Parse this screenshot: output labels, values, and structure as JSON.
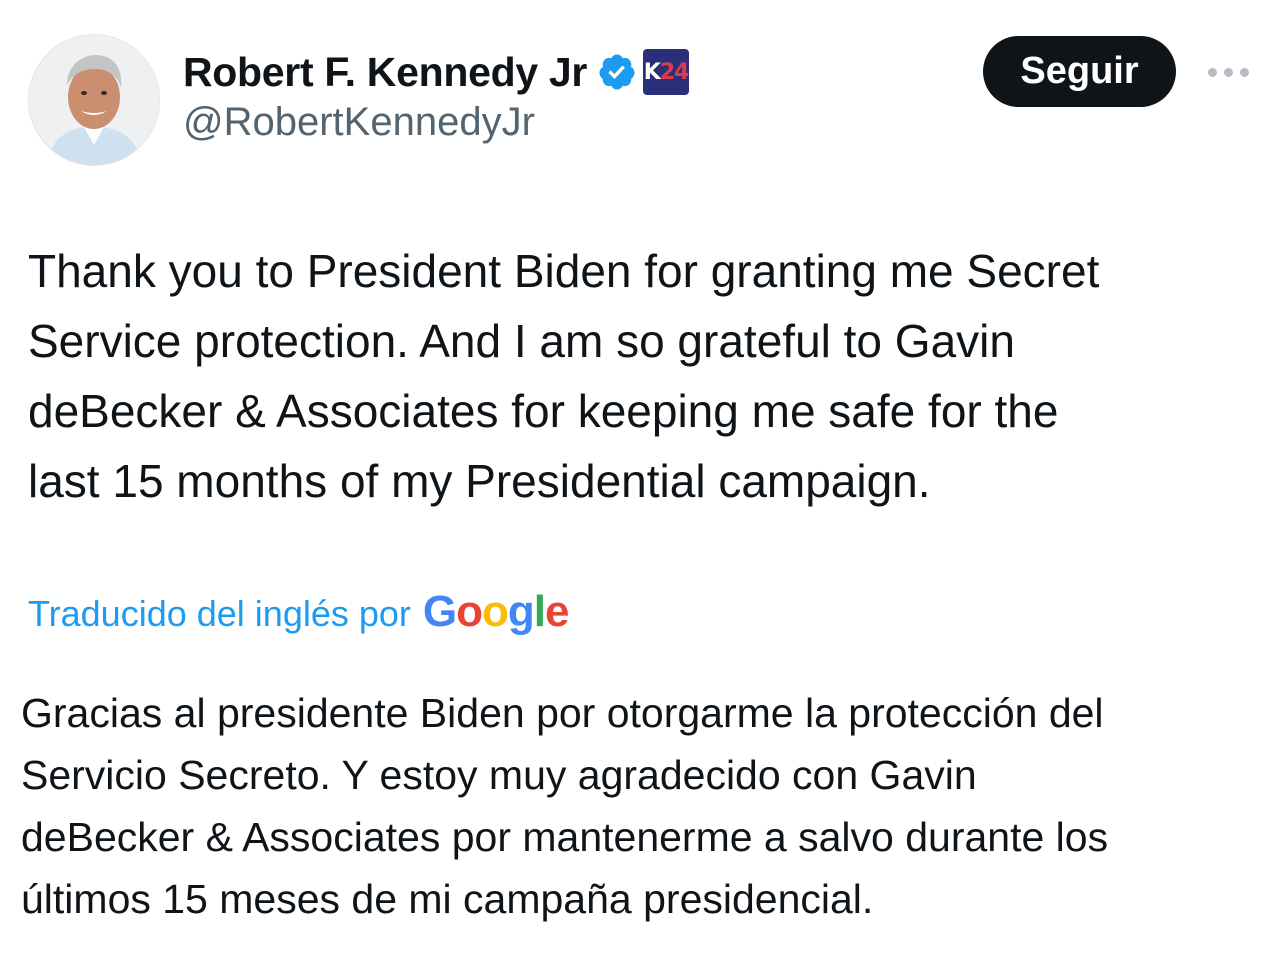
{
  "author": {
    "display_name": "Robert F. Kennedy Jr",
    "handle": "@RobertKennedyJr",
    "verified": true,
    "affiliate_badge_text": "K24"
  },
  "actions": {
    "follow_label": "Seguir",
    "more_icon": "more-horizontal-icon"
  },
  "tweet": {
    "text": "Thank you to President Biden for granting me Secret\nService protection. And I am so grateful to Gavin\ndeBecker & Associates for keeping me safe for the\nlast 15 months of my Presidential campaign."
  },
  "translation": {
    "label": "Traducido del inglés por",
    "provider": "Google",
    "text": "Gracias al presidente Biden por otorgarme la protección del\nServicio Secreto. Y estoy muy agradecido con Gavin\ndeBecker & Associates por mantenerme a salvo durante los\núltimos 15 meses de mi campaña presidencial."
  },
  "colors": {
    "link_blue": "#1d9bf0",
    "text_primary": "#0f1419",
    "text_secondary": "#536471",
    "button_bg": "#0f1419",
    "verified_blue": "#1d9bf0"
  }
}
